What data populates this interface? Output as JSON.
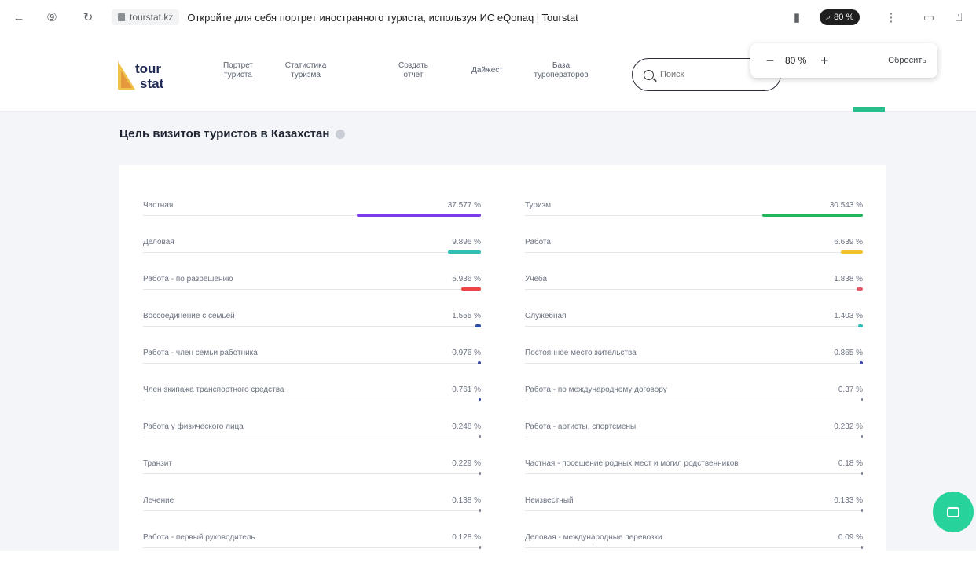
{
  "browser": {
    "domain": "tourstat.kz",
    "tab_title": "Откройте для себя портрет иностранного туриста, используя ИС eQonaq | Tourstat",
    "zoom_badge": "80 %"
  },
  "zoom_popup": {
    "minus": "−",
    "value": "80 %",
    "plus": "+",
    "reset": "Сбросить"
  },
  "header": {
    "logo_line1": "tour",
    "logo_line2": "stat",
    "nav": [
      "Портрет\nтуриста",
      "Статистика\nтуризма",
      "Создать\nотчет",
      "Дайжест",
      "База\nтуроператоров"
    ],
    "search_placeholder": "Поиск"
  },
  "section": {
    "title": "Цель визитов туристов в Казахстан"
  },
  "left_column": [
    {
      "label": "Частная",
      "value": "37.577 %",
      "percent": 37.577,
      "color": "#7c3aed"
    },
    {
      "label": "Деловая",
      "value": "9.896 %",
      "percent": 9.896,
      "color": "#2fbfb4"
    },
    {
      "label": "Работа - по разрешению",
      "value": "5.936 %",
      "percent": 5.936,
      "color": "#ef4444"
    },
    {
      "label": "Воссоединение с семьей",
      "value": "1.555 %",
      "percent": 1.555,
      "color": "#2b4fa8"
    },
    {
      "label": "Работа - член семьи работника",
      "value": "0.976 %",
      "percent": 0.976,
      "color": "#3b4aa8"
    },
    {
      "label": "Член экипажа транспортного средства",
      "value": "0.761 %",
      "percent": 0.761,
      "color": "#2a3b9a"
    },
    {
      "label": "Работа у физического лица",
      "value": "0.248 %",
      "percent": 0.248,
      "color": "#7a8090"
    },
    {
      "label": "Транзит",
      "value": "0.229 %",
      "percent": 0.229,
      "color": "#7a8090"
    },
    {
      "label": "Лечение",
      "value": "0.138 %",
      "percent": 0.138,
      "color": "#7a8090"
    },
    {
      "label": "Работа - первый руководитель",
      "value": "0.128 %",
      "percent": 0.128,
      "color": "#7a8090"
    }
  ],
  "right_column": [
    {
      "label": "Туризм",
      "value": "30.543 %",
      "percent": 30.543,
      "color": "#22b55a"
    },
    {
      "label": "Работа",
      "value": "6.639 %",
      "percent": 6.639,
      "color": "#f2c12e"
    },
    {
      "label": "Учеба",
      "value": "1.838 %",
      "percent": 1.838,
      "color": "#e05a6a"
    },
    {
      "label": "Служебная",
      "value": "1.403 %",
      "percent": 1.403,
      "color": "#2fbfb4"
    },
    {
      "label": "Постоянное место жительства",
      "value": "0.865 %",
      "percent": 0.865,
      "color": "#3b4aa8"
    },
    {
      "label": "Работа - по международному договору",
      "value": "0.37 %",
      "percent": 0.37,
      "color": "#7a8090"
    },
    {
      "label": "Работа - артисты, спортсмены",
      "value": "0.232 %",
      "percent": 0.232,
      "color": "#7a8090"
    },
    {
      "label": "Частная - посещение родных мест и могил родственников",
      "value": "0.18 %",
      "percent": 0.18,
      "color": "#7a8090"
    },
    {
      "label": "Неизвестный",
      "value": "0.133 %",
      "percent": 0.133,
      "color": "#7a8090"
    },
    {
      "label": "Деловая - международные перевозки",
      "value": "0.09 %",
      "percent": 0.09,
      "color": "#7a8090"
    }
  ]
}
